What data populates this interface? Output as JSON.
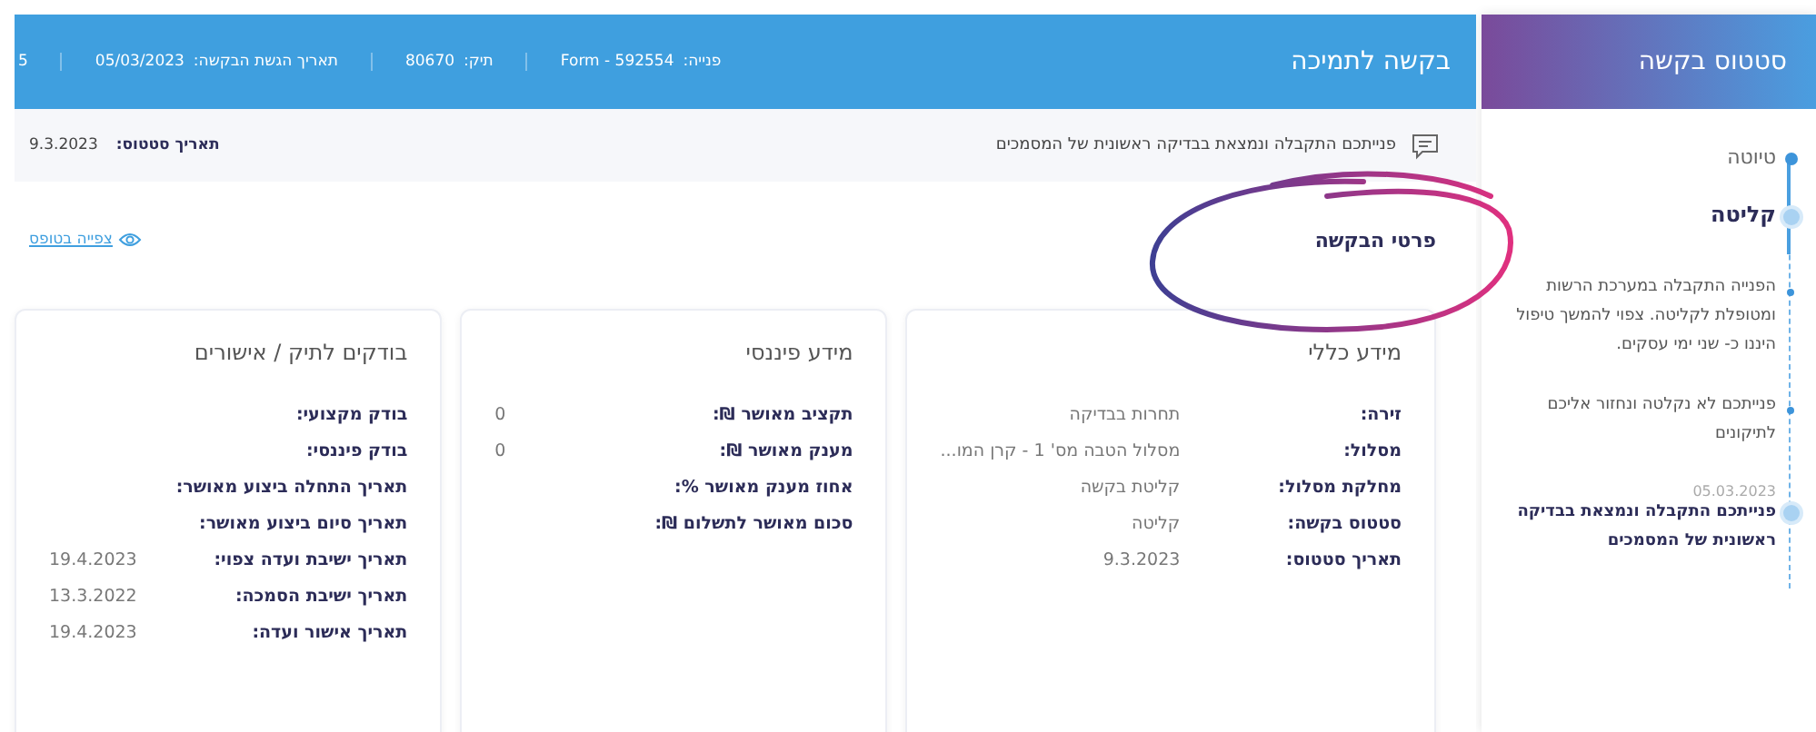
{
  "header": {
    "title": "בקשה לתמיכה",
    "meta": [
      {
        "label": "פנייה:",
        "value": "Form - 592554"
      },
      {
        "label": "תיק:",
        "value": "80670"
      },
      {
        "label": "תאריך הגשת הבקשה:",
        "value": "05/03/2023"
      },
      {
        "value": "5"
      }
    ]
  },
  "notice": {
    "message": "פנייתכם התקבלה ונמצאת בבדיקה ראשונית של המסמכים",
    "status_label": "תאריך סטטוס:",
    "status_value": "9.3.2023"
  },
  "section": {
    "title": "פרטי הבקשה",
    "view_link": "צפייה בטופס"
  },
  "cards": [
    {
      "title": "מידע כללי",
      "rows": [
        {
          "label": "זירה:",
          "value": "תחרות בבדיקה"
        },
        {
          "label": "מסלול:",
          "value": "מסלול הטבה מס' 1 - קרן המו..."
        },
        {
          "label": "מחלקת מסלול:",
          "value": "קליטת בקשה"
        },
        {
          "label": "סטטוס בקשה:",
          "value": "קליטה"
        },
        {
          "label": "תאריך סטטוס:",
          "value": "9.3.2023"
        }
      ]
    },
    {
      "title": "מידע פיננסי",
      "rows": [
        {
          "label": "תקציב מאושר ₪:",
          "value": "0"
        },
        {
          "label": "מענק מאושר ₪:",
          "value": "0"
        },
        {
          "label": "אחוז מענק מאושר %:"
        },
        {
          "label": "סכום מאושר לתשלום ₪:"
        }
      ]
    },
    {
      "title": "בודקים לתיק / אישורים",
      "rows": [
        {
          "label": "בודק מקצועי:"
        },
        {
          "label": "בודק פיננסי:"
        },
        {
          "label": "תאריך התחלה ביצוע מאושר:"
        },
        {
          "label": "תאריך סיום ביצוע מאושר:"
        },
        {
          "label": "תאריך ישיבת ועדה צפוי:",
          "value": "19.4.2023"
        },
        {
          "label": "תאריך ישיבת הסמכה:",
          "value": "13.3.2022"
        },
        {
          "label": "תאריך אישור ועדה:",
          "value": "19.4.2023"
        }
      ]
    }
  ],
  "sidebar": {
    "title": "סטטוס בקשה",
    "timeline": [
      {
        "kind": "stage",
        "label": "טיוטה",
        "current": false
      },
      {
        "kind": "stage",
        "label": "קליטה",
        "current": true
      },
      {
        "kind": "note",
        "text": "הפנייה התקבלה במערכת הרשות ומטופלת לקליטה. צפוי להמשך טיפול היננו כ- שני ימי עסקים."
      },
      {
        "kind": "note",
        "text": "פנייתכם לא נקלטה ונחזור אליכם לתיקונים"
      },
      {
        "kind": "event",
        "date": "05.03.2023",
        "text": "פנייתכם התקבלה ונמצאת בבדיקה ראשונית של המסמכים"
      }
    ]
  }
}
